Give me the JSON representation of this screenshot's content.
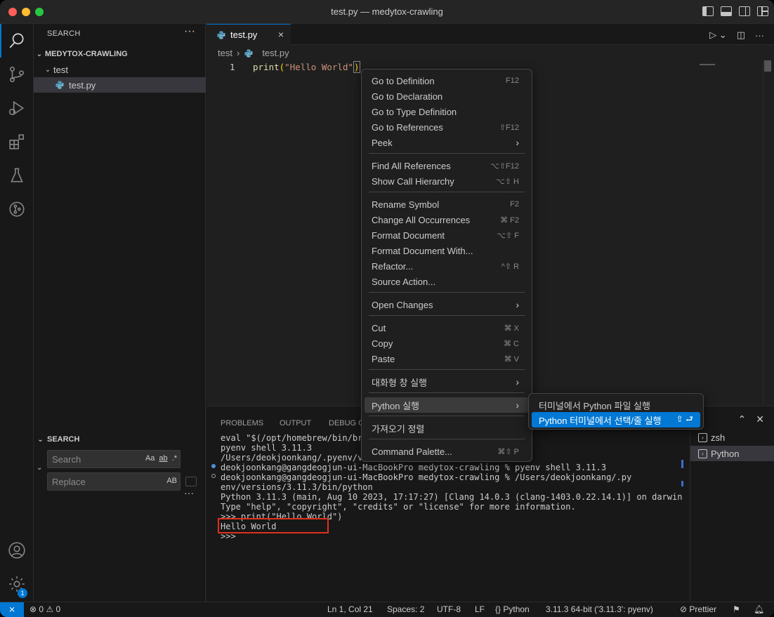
{
  "window": {
    "title": "test.py — medytox-crawling"
  },
  "sidebar": {
    "header": "SEARCH",
    "more": "···",
    "project": "MEDYTOX-CRAWLING",
    "folder": "test",
    "file": "test.py",
    "search_section": "SEARCH",
    "search_placeholder": "Search",
    "replace_placeholder": "Replace",
    "opt_case": "Aa",
    "opt_word": "ab",
    "opt_regex": ".*",
    "opt_preserve": "AB",
    "more2": "···"
  },
  "editor": {
    "tab": "test.py",
    "tab_close": "×",
    "breadcrumb": [
      "test",
      "test.py"
    ],
    "line_number": "1",
    "code": {
      "fn": "print",
      "open": "(",
      "str": "\"Hello World\"",
      "close": ")"
    }
  },
  "context_menu": {
    "items": [
      {
        "label": "Go to Definition",
        "kb": "F12"
      },
      {
        "label": "Go to Declaration",
        "kb": ""
      },
      {
        "label": "Go to Type Definition",
        "kb": ""
      },
      {
        "label": "Go to References",
        "kb": "⇧F12"
      },
      {
        "label": "Peek",
        "kb": ""
      },
      {
        "label": "Find All References",
        "kb": "⌥⇧F12"
      },
      {
        "label": "Show Call Hierarchy",
        "kb": "⌥⇧ H"
      },
      {
        "label": "Rename Symbol",
        "kb": "F2"
      },
      {
        "label": "Change All Occurrences",
        "kb": "⌘ F2"
      },
      {
        "label": "Format Document",
        "kb": "⌥⇧ F"
      },
      {
        "label": "Format Document With...",
        "kb": ""
      },
      {
        "label": "Refactor...",
        "kb": "^⇧ R"
      },
      {
        "label": "Source Action...",
        "kb": ""
      },
      {
        "label": "Open Changes",
        "kb": ""
      },
      {
        "label": "Cut",
        "kb": "⌘ X"
      },
      {
        "label": "Copy",
        "kb": "⌘ C"
      },
      {
        "label": "Paste",
        "kb": "⌘ V"
      },
      {
        "label": "대화형 창 실행",
        "kb": ""
      },
      {
        "label": "Python 실행",
        "kb": ""
      },
      {
        "label": "가져오기 정렬",
        "kb": ""
      },
      {
        "label": "Command Palette...",
        "kb": "⌘⇧ P"
      }
    ],
    "arrow": "›"
  },
  "submenu": {
    "items": [
      {
        "label": "터미널에서 Python 파일 실행",
        "kb": ""
      },
      {
        "label": "Python 터미널에서 선택/줄 실행",
        "kb": "⇧ ⮐"
      }
    ]
  },
  "panel": {
    "tabs": [
      "PROBLEMS",
      "OUTPUT",
      "DEBUG C"
    ],
    "terminal_lines": [
      "eval \"$(/opt/homebrew/bin/bre",
      "pyenv shell 3.11.3",
      "/Users/deokjoonkang/.pyenv/ve",
      "deokjoonkang@gangdeogjun-ui-MacBookPro medytox-crawling % pyenv shell 3.11.3",
      "deokjoonkang@gangdeogjun-ui-MacBookPro medytox-crawling % /Users/deokjoonkang/.py",
      "env/versions/3.11.3/bin/python",
      "Python 3.11.3 (main, Aug 10 2023, 17:17:27) [Clang 14.0.3 (clang-1403.0.22.14.1)] on darwin",
      "Type \"help\", \"copyright\", \"credits\" or \"license\" for more information.",
      ">>> print(\"Hello World\")",
      "Hello World",
      ">>>"
    ],
    "terminals": [
      "zsh",
      "Python"
    ]
  },
  "status": {
    "errors": "0",
    "warnings": "0",
    "position": "Ln 1, Col 21",
    "spaces": "Spaces: 2",
    "encoding": "UTF-8",
    "eol": "LF",
    "language": "Python",
    "interpreter": "3.11.3 64-bit ('3.11.3': pyenv)",
    "prettier": "Prettier"
  },
  "activity": {
    "badge": "1"
  },
  "colors": {
    "accent": "#0078d4",
    "highlight_box": "#e0301e"
  }
}
